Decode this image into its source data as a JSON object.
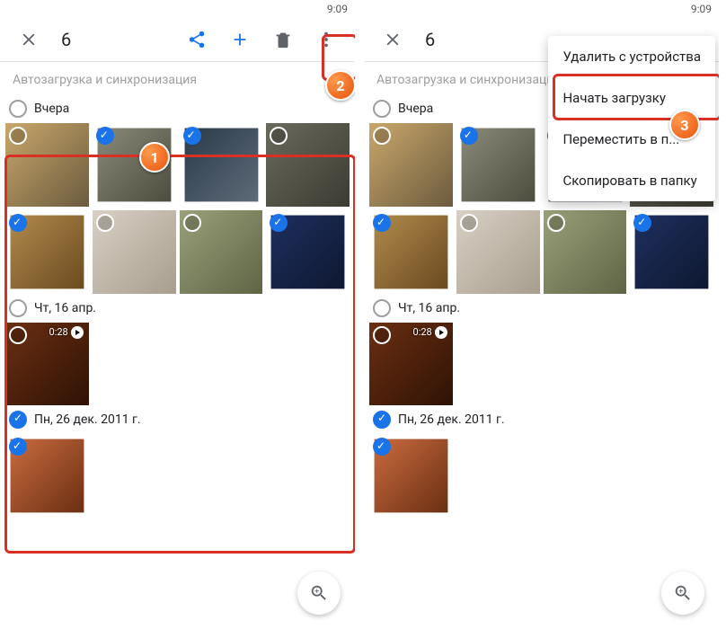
{
  "status": {
    "time": "9:09"
  },
  "appbar": {
    "count": "6"
  },
  "sections": {
    "autosync_label": "Автозагрузка и синхронизация",
    "day1": "Вчера",
    "day2": "Чт, 16 апр.",
    "day3": "Пн, 26 дек. 2011 г."
  },
  "video": {
    "duration": "0:28"
  },
  "menu": {
    "item1": "Удалить с устройства",
    "item2": "Начать загрузку",
    "item3": "Переместить в п...",
    "item4": "Скопировать в папку"
  },
  "callouts": {
    "n1": "1",
    "n2": "2",
    "n3": "3"
  }
}
